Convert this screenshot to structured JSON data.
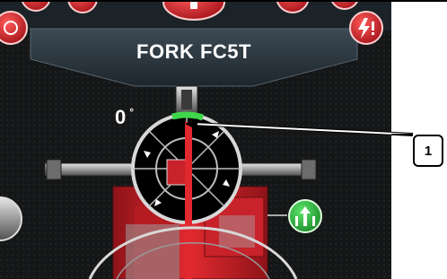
{
  "header": {
    "title": "FORK FC5T"
  },
  "orientation": {
    "angle_label": "0",
    "degree_symbol": "°"
  },
  "callout": {
    "number": "1"
  },
  "colors": {
    "accent_red": "#d8242a",
    "indicator_green": "#3fd64a",
    "button_green": "#2fb040",
    "panel_dark": "#2b3a44"
  },
  "icons": [
    "socket-icon",
    "lift-icon",
    "alert-bolt-icon",
    "fork-level-icon"
  ]
}
